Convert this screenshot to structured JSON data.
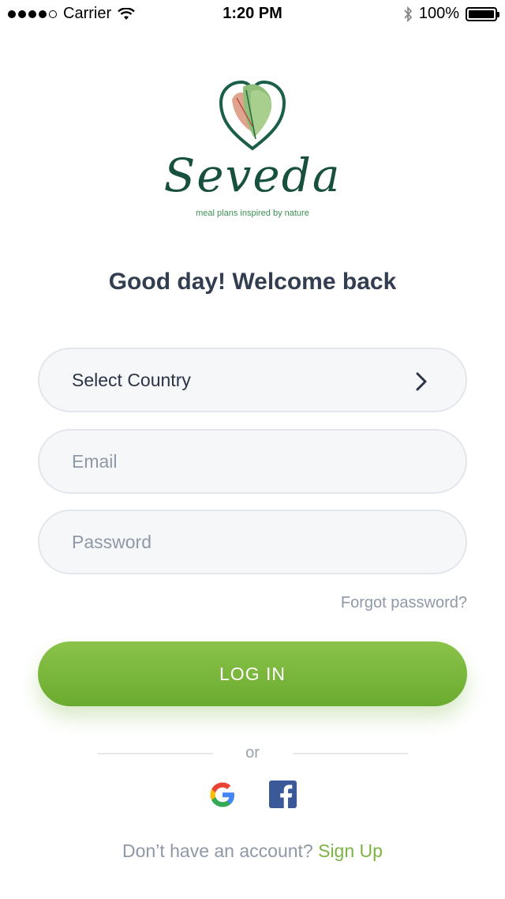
{
  "status_bar": {
    "carrier": "Carrier",
    "time": "1:20 PM",
    "battery_text": "100%",
    "battery_level": 1.0,
    "signal_bars_filled": 4,
    "signal_bars_total": 5
  },
  "logo": {
    "wordmark": "Seveda",
    "tagline": "meal plans inspired by nature"
  },
  "welcome_title": "Good day! Welcome back",
  "form": {
    "country_label": "Select Country",
    "email_placeholder": "Email",
    "password_placeholder": "Password",
    "forgot_password": "Forgot password?",
    "login_button": "LOG IN"
  },
  "divider_text": "or",
  "social": {
    "google_icon": "google-icon",
    "facebook_icon": "facebook-icon"
  },
  "signup": {
    "prompt": "Don’t have an account?",
    "link": "Sign Up"
  },
  "colors": {
    "accent_green": "#7cb342",
    "heading": "#323d50",
    "muted": "#8f98a6",
    "brand_dark_green": "#18503f",
    "facebook_blue": "#3b5998"
  }
}
